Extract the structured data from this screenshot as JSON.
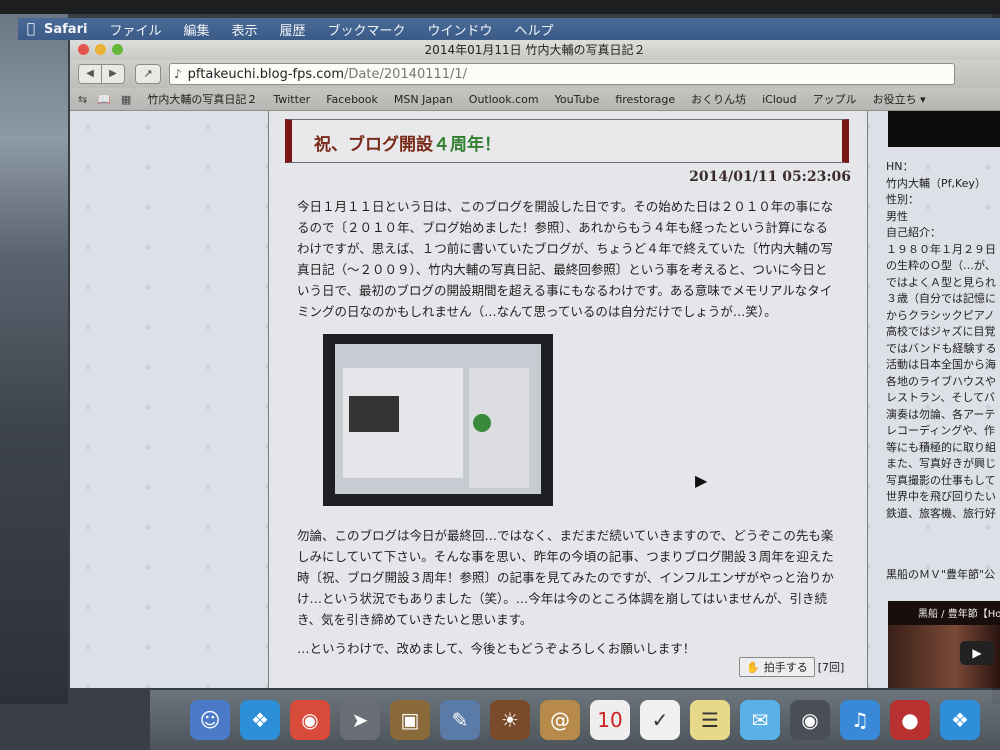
{
  "menubar": {
    "items": [
      "Safari",
      "ファイル",
      "編集",
      "表示",
      "履歴",
      "ブックマーク",
      "ウインドウ",
      "ヘルプ"
    ]
  },
  "window": {
    "title": "2014年01月11日 竹内大輔の写真日記２"
  },
  "toolbar": {
    "url_host": "pftakeuchi.blog-fps.com",
    "url_path": "/Date/20140111/1/"
  },
  "bookmarks": [
    "竹内大輔の写真日記２",
    "Twitter",
    "Facebook",
    "MSN Japan",
    "Outlook.com",
    "YouTube",
    "firestorage",
    "おくりん坊",
    "iCloud",
    "アップル",
    "お役立ち ▾"
  ],
  "post": {
    "title_a": "祝、ブログ開設",
    "title_b": "４周年！",
    "date": "2014/01/11 05:23:06",
    "p1": "今日１月１１日という日は、このブログを開設した日です。その始めた日は２０１０年の事になるので〔２０１０年、ブログ始めました！参照〕、あれからもう４年も経ったという計算になるわけですが、思えば、１つ前に書いていたブログが、ちょうど４年で終えていた〔竹内大輔の写真日記（～２００９）、竹内大輔の写真日記、最終回参照〕という事を考えると、ついに今日という日で、最初のブログの開設期間を超える事にもなるわけです。ある意味でメモリアルなタイミングの日なのかもしれません（…なんて思っているのは自分だけでしょうが…笑）。",
    "p2": "勿論、このブログは今日が最終回…ではなく、まだまだ続いていきますので、どうぞこの先も楽しみにしていて下さい。そんな事を思い、昨年の今頃の記事、つまりブログ開設３周年を迎えた時〔祝、ブログ開設３周年！参照〕の記事を見てみたのですが、インフルエンザがやっと治りかけ…という状況でもありました（笑）。…今年は今のところ体調を崩してはいませんが、引き続き、気を引き締めていきたいと思います。",
    "p3": "…というわけで、改めまして、今後ともどうぞよろしくお願いします！",
    "clap_label": "拍手する",
    "clap_count": "[7回]"
  },
  "sidebar": {
    "profile": [
      "HN：",
      "竹内大輔（Pf,Key）",
      "性別：",
      "男性",
      "自己紹介：",
      "１９８０年１月２９日",
      "の生粋のＯ型（…が、",
      "ではよくＡ型と見られ",
      "３歳（自分では記憶に",
      "からクラシックピアノ",
      "高校ではジャズに目覚",
      "ではバンドも経験する",
      "活動は日本全国から海",
      "各地のライブハウスや",
      "レストラン、そしてバ",
      "演奏は勿論、各アーテ",
      "レコーディングや、作",
      "等にも積極的に取り組",
      "また、写真好きが興じ",
      "写真撮影の仕事もして",
      "世界中を飛び回りたい",
      "鉄道、旅客機、旅行好"
    ],
    "mv_label": "黒船のＭＶ\"豊年節\"公",
    "video_title": "黒船 / 豊年節【Ho"
  },
  "dock": [
    "Finder",
    "Safari",
    "Chrome",
    "Launchpad",
    "Photos",
    "Preview",
    "iPhoto",
    "Mail",
    "Calendar",
    "Reminders",
    "Notes",
    "Messages",
    "FaceTime",
    "iTunes",
    "Photo Booth",
    "Safari"
  ]
}
